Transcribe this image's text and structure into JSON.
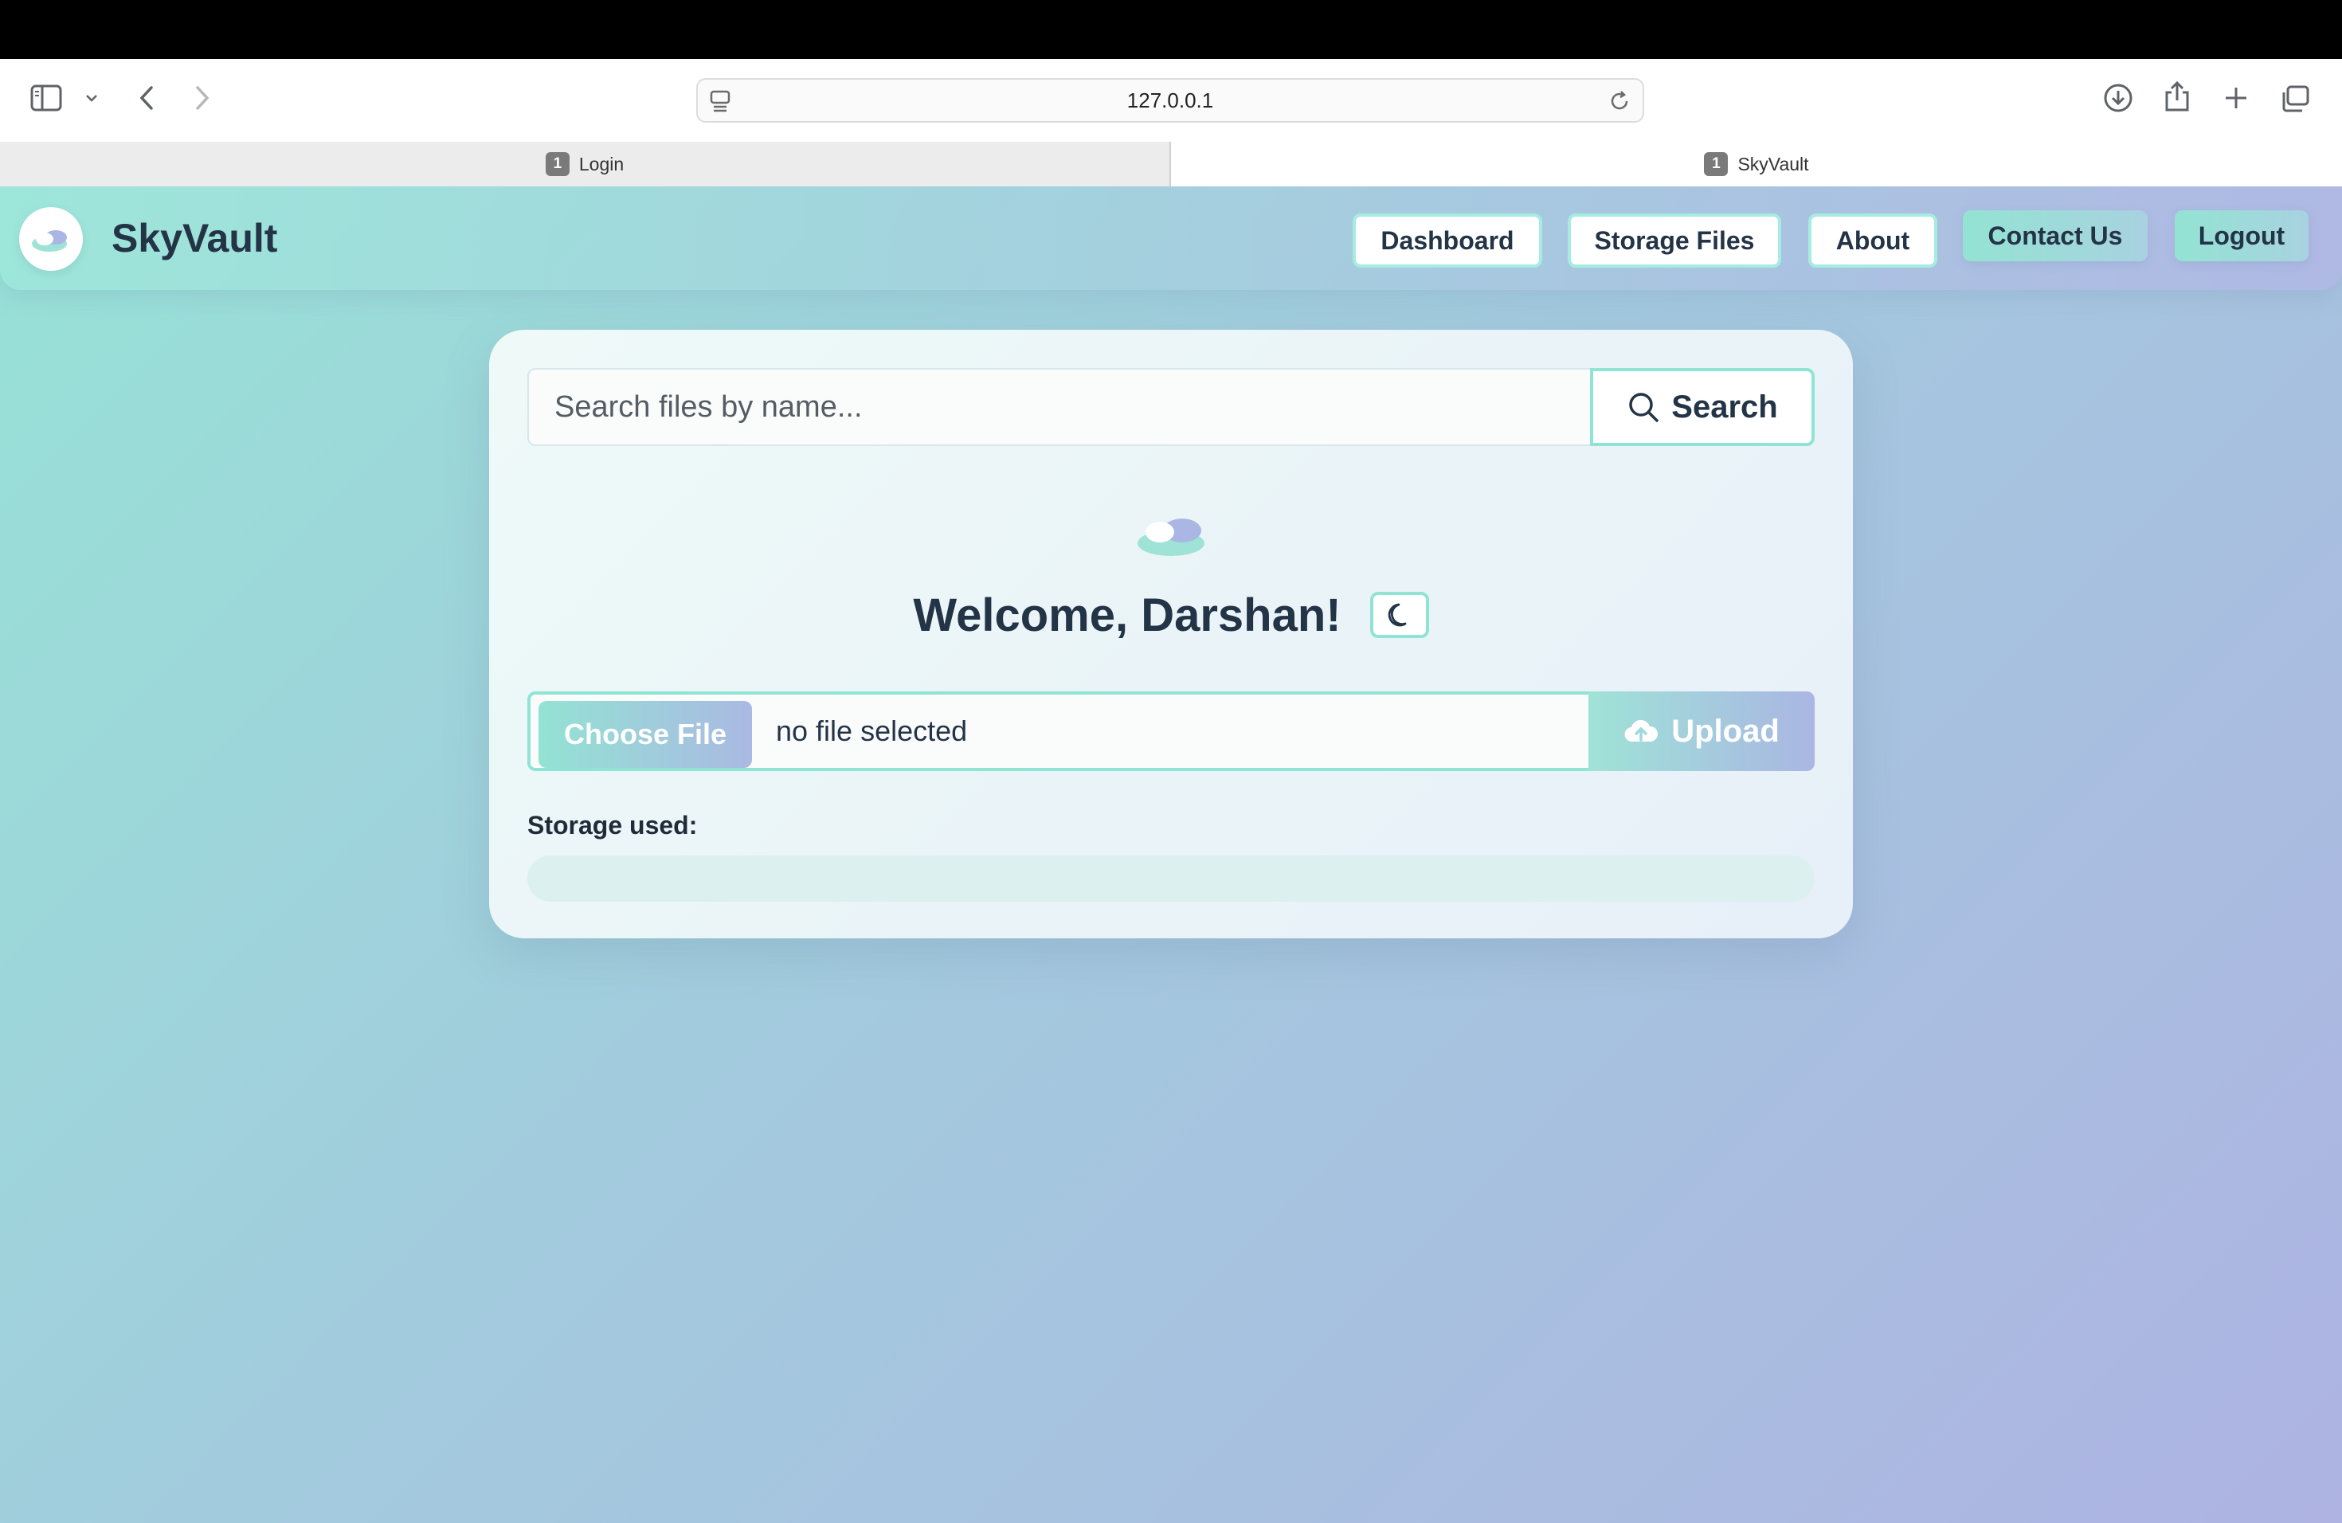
{
  "browser": {
    "url": "127.0.0.1",
    "tabs": [
      {
        "badge": "1",
        "label": "Login",
        "active": false
      },
      {
        "badge": "1",
        "label": "SkyVault",
        "active": true
      }
    ]
  },
  "app": {
    "brand": "SkyVault",
    "nav": {
      "dashboard": "Dashboard",
      "storage_files": "Storage Files",
      "about": "About",
      "contact": "Contact Us",
      "logout": "Logout"
    }
  },
  "search": {
    "placeholder": "Search files by name...",
    "button": "Search"
  },
  "welcome": {
    "text": "Welcome, Darshan!"
  },
  "upload": {
    "choose_label": "Choose File",
    "file_status": "no file selected",
    "button": "Upload"
  },
  "storage": {
    "label": "Storage used:",
    "used_fraction": 0
  },
  "colors": {
    "accent_teal": "#8fe4d4",
    "accent_lavender": "#aab6e3",
    "text_dark": "#243447"
  },
  "icons": {
    "sidebar": "sidebar-toggle-icon",
    "back": "chevron-left-icon",
    "forward": "chevron-right-icon",
    "download": "download-icon",
    "share": "share-icon",
    "new_tab": "plus-icon",
    "tabs": "tab-overview-icon",
    "search": "magnifier-icon",
    "theme": "moon-icon",
    "upload": "cloud-upload-icon"
  }
}
